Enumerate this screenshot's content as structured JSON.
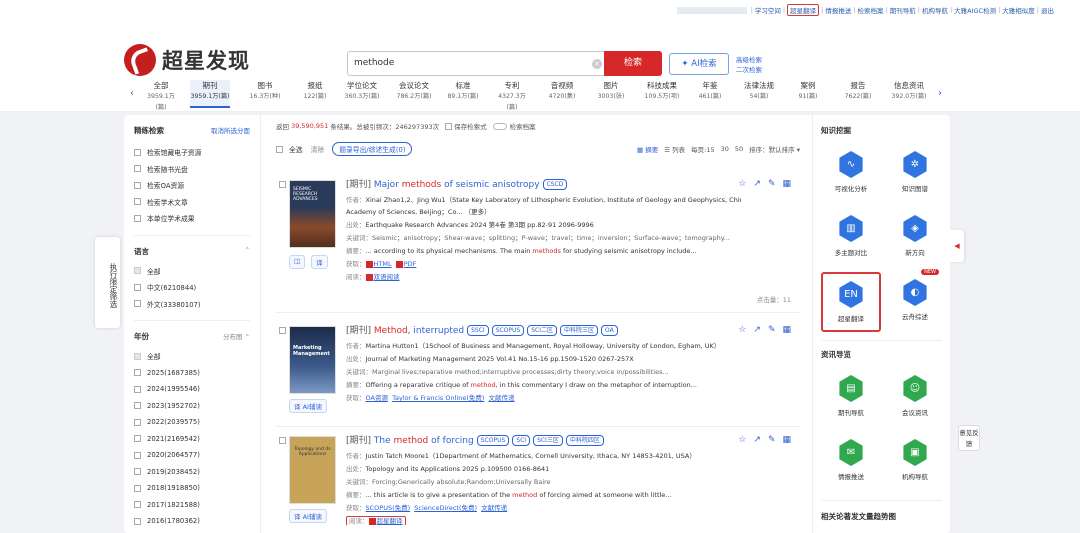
{
  "toplinks": [
    "学习空间",
    "超星翻译",
    "情报推送",
    "检索档案",
    "期刊导航",
    "机构导航",
    "大雅AIGC检测",
    "大雅相似度",
    "退出"
  ],
  "logo": {
    "text": "超星发现"
  },
  "search": {
    "value": "methode",
    "button": "检索",
    "ai_button": "AI检索",
    "advanced": "高级检索",
    "secondary": "二次检索"
  },
  "categories": [
    {
      "name": "全部",
      "count": "3959.1万(篇)"
    },
    {
      "name": "期刊",
      "count": "3959.1万(篇)"
    },
    {
      "name": "图书",
      "count": "16.3万(种)"
    },
    {
      "name": "报纸",
      "count": "122(篇)"
    },
    {
      "name": "学位论文",
      "count": "360.3万(篇)"
    },
    {
      "name": "会议论文",
      "count": "786.2万(篇)"
    },
    {
      "name": "标准",
      "count": "89.1万(篇)"
    },
    {
      "name": "专利",
      "count": "4327.3万(篇)"
    },
    {
      "name": "音视频",
      "count": "4720(集)"
    },
    {
      "name": "图片",
      "count": "3003(张)"
    },
    {
      "name": "科技成果",
      "count": "109.5万(项)"
    },
    {
      "name": "年鉴",
      "count": "461(篇)"
    },
    {
      "name": "法律法规",
      "count": "54(篇)"
    },
    {
      "name": "案例",
      "count": "91(篇)"
    },
    {
      "name": "报告",
      "count": "7622(篇)"
    },
    {
      "name": "信息资讯",
      "count": "392.0万(篇)"
    }
  ],
  "left": {
    "title": "精练检索",
    "clear": "取消所选分面",
    "refine": [
      "检索馆藏电子资源",
      "检索随书光盘",
      "检索OA资源",
      "检索学术文章",
      "本单位学术成果"
    ],
    "lang_title": "语言",
    "langs": [
      "全部",
      "中文(6210844)",
      "外文(33380107)"
    ],
    "year_title": "年份",
    "year_right": "分布图",
    "years": [
      "全部",
      "2025(1687385)",
      "2024(1995546)",
      "2023(1952702)",
      "2022(2039575)",
      "2021(2169542)",
      "2020(2064577)",
      "2019(2038452)",
      "2018(1918850)",
      "2017(1821588)",
      "2016(1780362)"
    ],
    "vtab": "执行限定筛选"
  },
  "stats": {
    "prefix": "返回",
    "count": "39,590,951",
    "mid": "条结果。总被引频次：",
    "cites": "246297393次",
    "save": "保存检索式",
    "archive": "检索档案"
  },
  "toolbar": {
    "all": "全选",
    "clear": "清除",
    "export": "题录导出/综述生成(0)",
    "abstract": "摘要",
    "list": "列表",
    "per_page": "每页:15",
    "p30": "30",
    "p50": "50",
    "sort": "排序：默认排序"
  },
  "records": [
    {
      "type": "[期刊]",
      "title_pre": "Major ",
      "title_kw": "methods",
      "title_post": " of seismic anisotropy",
      "tags": [
        "CSCD"
      ],
      "author": "Xinai Zhao1,2、Jing Wu1（State Key Laboratory of Lithospheric Evolution, Institute of Geology and Geophysics, Chinese",
      "author2": "Academy of Sciences, Beijing；Co... （更多）",
      "source": "Earthquake Research Advances 2024 第4卷 第3期 pp.82-91 2096-9996",
      "keywords": "Seismic；anisotropy；Shear-wave；splitting；P-wave；travel；time；inversion；Surface-wave；tomography...",
      "abstract_pre": "... according to its physical mechanisms. The main ",
      "abstract_kw": "methods",
      "abstract_post": " for studying seismic anisotropy include...",
      "get1": "HTML",
      "get2": "PDF",
      "read": "双语阅读",
      "views": "点击量：11",
      "thumb_label": "SEISMIC RESEARCH ADVANCES"
    },
    {
      "type": "[期刊]",
      "title_pre": "",
      "title_kw": "Method",
      "title_post": ", interrupted",
      "tags": [
        "SSCI",
        "SCOPUS",
        "SCI二区",
        "中科院三区",
        "OA"
      ],
      "author": "Martina Hutton1（1School of Business and Management, Royal Holloway, University of London, Egham, UK）",
      "source": "Journal of Marketing Management 2025 Vol.41 No.15-16 pp.1509-1520 0267-257X",
      "keywords": "Marginal lives;reparative method;interruptive processes;dirty theory;voice in/possibilities...",
      "abstract_pre": "Offering a reparative critique of ",
      "abstract_kw": "method",
      "abstract_post": ", in this commentary I draw on the metaphor of interruption...",
      "get1": "OA资源",
      "get2": "Taylor & Francis Online(免费)",
      "get3": "文献传递",
      "thumb_label": "Marketing Management"
    },
    {
      "type": "[期刊]",
      "title_pre": "The ",
      "title_kw": "method",
      "title_post": " of forcing",
      "tags": [
        "SCOPUS",
        "SCI",
        "SCI三区",
        "中科院四区"
      ],
      "author": "Justin Tatch Moore1（1Department of Mathematics, Cornell University, Ithaca, NY 14853-4201, USA）",
      "source": "Topology and its Applications 2025 p.109500 0166-8641",
      "keywords": "Forcing;Generically absolute;Random;Universally Baire",
      "abstract_pre": "... this article is to give a presentation of the ",
      "abstract_kw": "method",
      "abstract_post": " of forcing aimed at someone with little...",
      "get1": "SCOPUS(免费)",
      "get2": "ScienceDirect(免费)",
      "get3": "文献传递",
      "read": "超星翻译",
      "thumb_label": "Topology and its Applications"
    }
  ],
  "labels": {
    "author": "作者：",
    "source": "出处：",
    "keywords": "关键词：",
    "abstract": "摘要：",
    "get": "获取：",
    "read": "阅读：",
    "ai_read": "AI辅读"
  },
  "right": {
    "km_title": "知识挖掘",
    "km": [
      "可视化分析",
      "知识图谱",
      "多主题对比",
      "新方向",
      "超星翻译",
      "云舟综述"
    ],
    "new": "NEW",
    "nav_title": "资讯导览",
    "nav": [
      "期刊导航",
      "会议资讯",
      "情报推送",
      "机构导航"
    ],
    "trend_title": "相关论著发文量趋势图"
  },
  "feedback": "意见反馈"
}
